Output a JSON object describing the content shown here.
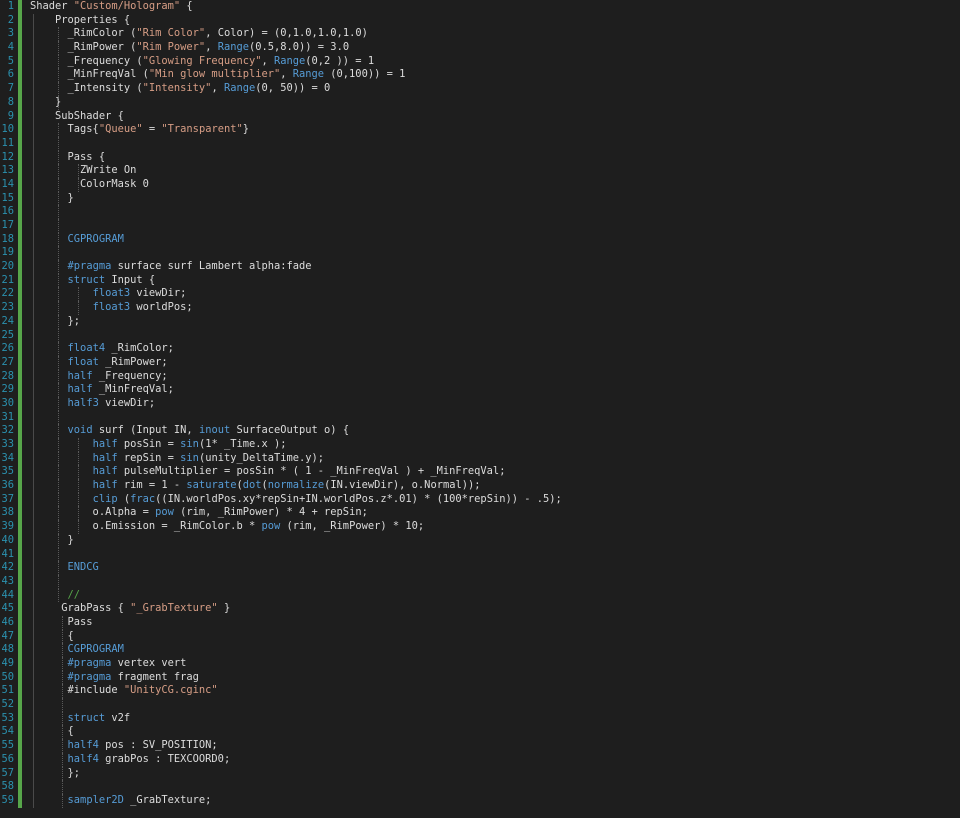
{
  "editor": {
    "language": "ShaderLab / Cg",
    "colors": {
      "background": "#1e1e1e",
      "line_number": "#2b91af",
      "change_bar": "#57a64a",
      "default": "#dcdcdc",
      "keyword": "#569cd6",
      "string": "#d69d85",
      "preprocessor": "#9b9b9b",
      "comment": "#57a64a"
    },
    "lines": [
      {
        "n": "1",
        "bar": true,
        "tokens": [
          {
            "t": "Shader ",
            "c": "default"
          },
          {
            "t": "\"Custom/Hologram\"",
            "c": "str"
          },
          {
            "t": " {",
            "c": "default"
          }
        ]
      },
      {
        "n": "2",
        "bar": true,
        "tokens": [
          {
            "t": "    Properties {",
            "c": "default"
          }
        ]
      },
      {
        "n": "3",
        "bar": true,
        "tokens": [
          {
            "t": "      _RimColor (",
            "c": "default"
          },
          {
            "t": "\"Rim Color\"",
            "c": "str"
          },
          {
            "t": ", Color) = (0,1.0,1.0,1.0)",
            "c": "default"
          }
        ]
      },
      {
        "n": "4",
        "bar": true,
        "tokens": [
          {
            "t": "      _RimPower (",
            "c": "default"
          },
          {
            "t": "\"Rim Power\"",
            "c": "str"
          },
          {
            "t": ", ",
            "c": "default"
          },
          {
            "t": "Range",
            "c": "kw"
          },
          {
            "t": "(0.5,8.0)) = 3.0",
            "c": "default"
          }
        ]
      },
      {
        "n": "5",
        "bar": true,
        "tokens": [
          {
            "t": "      _Frequency (",
            "c": "default"
          },
          {
            "t": "\"Glowing Frequency\"",
            "c": "str"
          },
          {
            "t": ", ",
            "c": "default"
          },
          {
            "t": "Range",
            "c": "kw"
          },
          {
            "t": "(0,2 )) = 1",
            "c": "default"
          }
        ]
      },
      {
        "n": "6",
        "bar": true,
        "tokens": [
          {
            "t": "      _MinFreqVal (",
            "c": "default"
          },
          {
            "t": "\"Min glow multiplier\"",
            "c": "str"
          },
          {
            "t": ", ",
            "c": "default"
          },
          {
            "t": "Range",
            "c": "kw"
          },
          {
            "t": " (0,100)) = 1",
            "c": "default"
          }
        ]
      },
      {
        "n": "7",
        "bar": true,
        "tokens": [
          {
            "t": "      _Intensity (",
            "c": "default"
          },
          {
            "t": "\"Intensity\"",
            "c": "str"
          },
          {
            "t": ", ",
            "c": "default"
          },
          {
            "t": "Range",
            "c": "kw"
          },
          {
            "t": "(0, 50)) = 0",
            "c": "default"
          }
        ]
      },
      {
        "n": "8",
        "bar": true,
        "tokens": [
          {
            "t": "    }",
            "c": "default"
          }
        ]
      },
      {
        "n": "9",
        "bar": true,
        "tokens": [
          {
            "t": "    SubShader {",
            "c": "default"
          }
        ]
      },
      {
        "n": "10",
        "bar": true,
        "tokens": [
          {
            "t": "      Tags{",
            "c": "default"
          },
          {
            "t": "\"Queue\"",
            "c": "str"
          },
          {
            "t": " = ",
            "c": "default"
          },
          {
            "t": "\"Transparent\"",
            "c": "str"
          },
          {
            "t": "}",
            "c": "default"
          }
        ]
      },
      {
        "n": "11",
        "bar": true,
        "tokens": []
      },
      {
        "n": "12",
        "bar": true,
        "tokens": [
          {
            "t": "      Pass {",
            "c": "default"
          }
        ]
      },
      {
        "n": "13",
        "bar": true,
        "tokens": [
          {
            "t": "        ZWrite On",
            "c": "default"
          }
        ]
      },
      {
        "n": "14",
        "bar": true,
        "tokens": [
          {
            "t": "        ColorMask 0",
            "c": "default"
          }
        ]
      },
      {
        "n": "15",
        "bar": true,
        "tokens": [
          {
            "t": "      }",
            "c": "default"
          }
        ]
      },
      {
        "n": "16",
        "bar": true,
        "tokens": []
      },
      {
        "n": "17",
        "bar": true,
        "tokens": []
      },
      {
        "n": "18",
        "bar": true,
        "tokens": [
          {
            "t": "      CGPROGRAM",
            "c": "kw"
          }
        ]
      },
      {
        "n": "19",
        "bar": true,
        "tokens": []
      },
      {
        "n": "20",
        "bar": true,
        "tokens": [
          {
            "t": "      ",
            "c": "default"
          },
          {
            "t": "#pragma",
            "c": "kw"
          },
          {
            "t": " surface surf Lambert alpha:fade",
            "c": "default"
          }
        ]
      },
      {
        "n": "21",
        "bar": true,
        "tokens": [
          {
            "t": "      ",
            "c": "default"
          },
          {
            "t": "struct",
            "c": "kw"
          },
          {
            "t": " Input {",
            "c": "default"
          }
        ]
      },
      {
        "n": "22",
        "bar": true,
        "tokens": [
          {
            "t": "          ",
            "c": "default"
          },
          {
            "t": "float3",
            "c": "kw"
          },
          {
            "t": " viewDir;",
            "c": "default"
          }
        ]
      },
      {
        "n": "23",
        "bar": true,
        "tokens": [
          {
            "t": "          ",
            "c": "default"
          },
          {
            "t": "float3",
            "c": "kw"
          },
          {
            "t": " worldPos;",
            "c": "default"
          }
        ]
      },
      {
        "n": "24",
        "bar": true,
        "tokens": [
          {
            "t": "      };",
            "c": "default"
          }
        ]
      },
      {
        "n": "25",
        "bar": true,
        "tokens": []
      },
      {
        "n": "26",
        "bar": true,
        "tokens": [
          {
            "t": "      ",
            "c": "default"
          },
          {
            "t": "float4",
            "c": "kw"
          },
          {
            "t": " _RimColor;",
            "c": "default"
          }
        ]
      },
      {
        "n": "27",
        "bar": true,
        "tokens": [
          {
            "t": "      ",
            "c": "default"
          },
          {
            "t": "float",
            "c": "kw"
          },
          {
            "t": " _RimPower;",
            "c": "default"
          }
        ]
      },
      {
        "n": "28",
        "bar": true,
        "tokens": [
          {
            "t": "      ",
            "c": "default"
          },
          {
            "t": "half",
            "c": "kw"
          },
          {
            "t": " _Frequency;",
            "c": "default"
          }
        ]
      },
      {
        "n": "29",
        "bar": true,
        "tokens": [
          {
            "t": "      ",
            "c": "default"
          },
          {
            "t": "half",
            "c": "kw"
          },
          {
            "t": " _MinFreqVal;",
            "c": "default"
          }
        ]
      },
      {
        "n": "30",
        "bar": true,
        "tokens": [
          {
            "t": "      ",
            "c": "default"
          },
          {
            "t": "half3",
            "c": "kw"
          },
          {
            "t": " viewDir;",
            "c": "default"
          }
        ]
      },
      {
        "n": "31",
        "bar": true,
        "tokens": []
      },
      {
        "n": "32",
        "bar": true,
        "tokens": [
          {
            "t": "      ",
            "c": "default"
          },
          {
            "t": "void",
            "c": "kw"
          },
          {
            "t": " surf (Input IN, ",
            "c": "default"
          },
          {
            "t": "inout",
            "c": "kw"
          },
          {
            "t": " SurfaceOutput o) {",
            "c": "default"
          }
        ]
      },
      {
        "n": "33",
        "bar": true,
        "tokens": [
          {
            "t": "          ",
            "c": "default"
          },
          {
            "t": "half",
            "c": "kw"
          },
          {
            "t": " posSin = ",
            "c": "default"
          },
          {
            "t": "sin",
            "c": "kw"
          },
          {
            "t": "(1* _Time.x );",
            "c": "default"
          }
        ]
      },
      {
        "n": "34",
        "bar": true,
        "tokens": [
          {
            "t": "          ",
            "c": "default"
          },
          {
            "t": "half",
            "c": "kw"
          },
          {
            "t": " repSin = ",
            "c": "default"
          },
          {
            "t": "sin",
            "c": "kw"
          },
          {
            "t": "(unity_DeltaTime.y);",
            "c": "default"
          }
        ]
      },
      {
        "n": "35",
        "bar": true,
        "tokens": [
          {
            "t": "          ",
            "c": "default"
          },
          {
            "t": "half",
            "c": "kw"
          },
          {
            "t": " pulseMultiplier = posSin * ( 1 - _MinFreqVal ) + _MinFreqVal;",
            "c": "default"
          }
        ]
      },
      {
        "n": "36",
        "bar": true,
        "tokens": [
          {
            "t": "          ",
            "c": "default"
          },
          {
            "t": "half",
            "c": "kw"
          },
          {
            "t": " rim = 1 - ",
            "c": "default"
          },
          {
            "t": "saturate",
            "c": "kw"
          },
          {
            "t": "(",
            "c": "default"
          },
          {
            "t": "dot",
            "c": "kw"
          },
          {
            "t": "(",
            "c": "default"
          },
          {
            "t": "normalize",
            "c": "kw"
          },
          {
            "t": "(IN.viewDir), o.Normal));",
            "c": "default"
          }
        ]
      },
      {
        "n": "37",
        "bar": true,
        "tokens": [
          {
            "t": "          ",
            "c": "default"
          },
          {
            "t": "clip",
            "c": "kw"
          },
          {
            "t": " (",
            "c": "default"
          },
          {
            "t": "frac",
            "c": "kw"
          },
          {
            "t": "((IN.worldPos.xy*repSin+IN.worldPos.z*.01) * (100*repSin)) - .5);",
            "c": "default"
          }
        ]
      },
      {
        "n": "38",
        "bar": true,
        "tokens": [
          {
            "t": "          o.Alpha = ",
            "c": "default"
          },
          {
            "t": "pow",
            "c": "kw"
          },
          {
            "t": " (rim, _RimPower) * 4 + repSin;",
            "c": "default"
          }
        ]
      },
      {
        "n": "39",
        "bar": true,
        "tokens": [
          {
            "t": "          o.Emission = _RimColor.b * ",
            "c": "default"
          },
          {
            "t": "pow",
            "c": "kw"
          },
          {
            "t": " (rim, _RimPower) * 10;",
            "c": "default"
          }
        ]
      },
      {
        "n": "40",
        "bar": true,
        "tokens": [
          {
            "t": "      }",
            "c": "default"
          }
        ]
      },
      {
        "n": "41",
        "bar": true,
        "tokens": []
      },
      {
        "n": "42",
        "bar": true,
        "tokens": [
          {
            "t": "      ENDCG",
            "c": "kw"
          }
        ]
      },
      {
        "n": "43",
        "bar": true,
        "tokens": []
      },
      {
        "n": "44",
        "bar": true,
        "tokens": [
          {
            "t": "      //",
            "c": "cm"
          }
        ]
      },
      {
        "n": "45",
        "bar": true,
        "tokens": [
          {
            "t": "     GrabPass { ",
            "c": "default"
          },
          {
            "t": "\"_GrabTexture\"",
            "c": "str"
          },
          {
            "t": " }",
            "c": "default"
          }
        ]
      },
      {
        "n": "46",
        "bar": true,
        "tokens": [
          {
            "t": "      Pass",
            "c": "default"
          }
        ]
      },
      {
        "n": "47",
        "bar": true,
        "tokens": [
          {
            "t": "      {",
            "c": "default"
          }
        ]
      },
      {
        "n": "48",
        "bar": true,
        "tokens": [
          {
            "t": "      CGPROGRAM",
            "c": "kw"
          }
        ]
      },
      {
        "n": "49",
        "bar": true,
        "tokens": [
          {
            "t": "      ",
            "c": "default"
          },
          {
            "t": "#pragma",
            "c": "kw"
          },
          {
            "t": " vertex vert",
            "c": "default"
          }
        ]
      },
      {
        "n": "50",
        "bar": true,
        "tokens": [
          {
            "t": "      ",
            "c": "default"
          },
          {
            "t": "#pragma",
            "c": "kw"
          },
          {
            "t": " fragment frag",
            "c": "default"
          }
        ]
      },
      {
        "n": "51",
        "bar": true,
        "tokens": [
          {
            "t": "      #include ",
            "c": "default"
          },
          {
            "t": "\"UnityCG.cginc\"",
            "c": "str"
          }
        ]
      },
      {
        "n": "52",
        "bar": true,
        "tokens": []
      },
      {
        "n": "53",
        "bar": true,
        "tokens": [
          {
            "t": "      ",
            "c": "default"
          },
          {
            "t": "struct",
            "c": "kw"
          },
          {
            "t": " v2f",
            "c": "default"
          }
        ]
      },
      {
        "n": "54",
        "bar": true,
        "tokens": [
          {
            "t": "      {",
            "c": "default"
          }
        ]
      },
      {
        "n": "55",
        "bar": true,
        "tokens": [
          {
            "t": "      ",
            "c": "default"
          },
          {
            "t": "half4",
            "c": "kw"
          },
          {
            "t": " pos : SV_POSITION;",
            "c": "default"
          }
        ]
      },
      {
        "n": "56",
        "bar": true,
        "tokens": [
          {
            "t": "      ",
            "c": "default"
          },
          {
            "t": "half4",
            "c": "kw"
          },
          {
            "t": " grabPos : TEXCOORD0;",
            "c": "default"
          }
        ]
      },
      {
        "n": "57",
        "bar": true,
        "tokens": [
          {
            "t": "      };",
            "c": "default"
          }
        ]
      },
      {
        "n": "58",
        "bar": true,
        "tokens": []
      },
      {
        "n": "59",
        "bar": true,
        "tokens": [
          {
            "t": "      ",
            "c": "default"
          },
          {
            "t": "sampler2D",
            "c": "kw"
          },
          {
            "t": " _GrabTexture;",
            "c": "default"
          }
        ]
      }
    ]
  }
}
